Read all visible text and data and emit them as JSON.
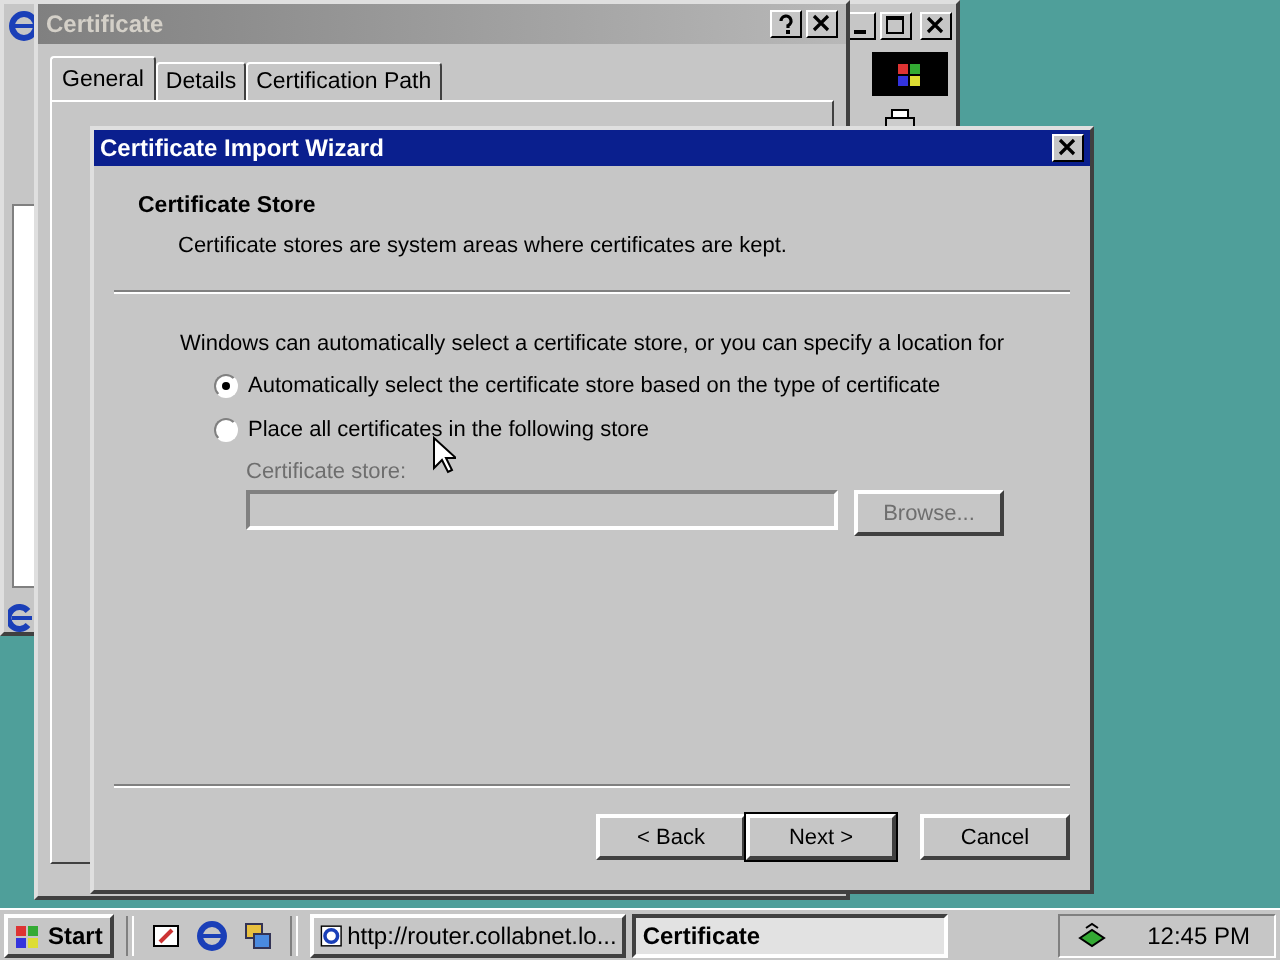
{
  "dialog": {
    "title": "Certificate",
    "tabs": [
      {
        "label": "General",
        "selected": true
      },
      {
        "label": "Details",
        "selected": false
      },
      {
        "label": "Certification Path",
        "selected": false
      }
    ]
  },
  "wizard": {
    "title": "Certificate Import Wizard",
    "heading": "Certificate Store",
    "subtitle": "Certificate stores are system areas where certificates are kept.",
    "intro": "Windows can automatically select a certificate store, or you can specify a location for",
    "options": [
      {
        "label": "Automatically select the certificate store based on the type of certificate",
        "selected": true
      },
      {
        "label": "Place all certificates in the following store",
        "selected": false
      }
    ],
    "store": {
      "label": "Certificate store:",
      "disabled": true,
      "browse": "Browse..."
    },
    "buttons": [
      {
        "label": "< Back",
        "default": false
      },
      {
        "label": "Next >",
        "default": true
      },
      {
        "label": "Cancel",
        "default": false
      }
    ]
  },
  "taskbar": {
    "start": "Start",
    "tasks": [
      {
        "label": "http://router.collabnet.lo...",
        "selected": false
      },
      {
        "label": "Certificate",
        "selected": true
      }
    ],
    "clock": "12:45 PM"
  }
}
